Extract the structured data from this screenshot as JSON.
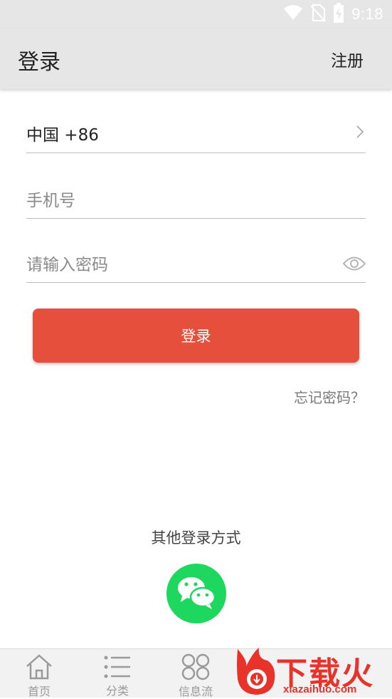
{
  "status_bar": {
    "time": "9:18"
  },
  "app_bar": {
    "title": "登录",
    "register_label": "注册"
  },
  "form": {
    "country": "中国 +86",
    "phone_placeholder": "手机号",
    "password_placeholder": "请输入密码",
    "login_button": "登录",
    "forgot_password": "忘记密码？"
  },
  "other_login": {
    "title": "其他登录方式",
    "wechat_icon": "wechat-icon"
  },
  "bottom_nav": {
    "items": [
      {
        "label": "首页",
        "icon": "home-icon"
      },
      {
        "label": "分类",
        "icon": "list-icon"
      },
      {
        "label": "信息流",
        "icon": "grid-circles-icon"
      }
    ]
  },
  "watermark": {
    "text": "下载火",
    "site": "xiazaihuo.com"
  },
  "colors": {
    "accent": "#e64f3c",
    "wechat": "#1ed75f",
    "app_bar": "#e6e6e6"
  }
}
